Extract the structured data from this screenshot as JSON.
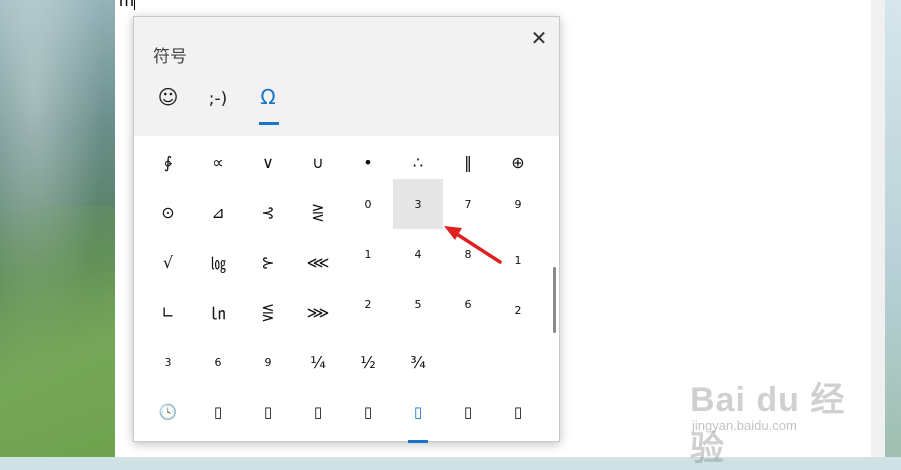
{
  "document": {
    "text": "m"
  },
  "panel": {
    "title": "符号",
    "close_glyph": "✕",
    "tabs": [
      {
        "label": "☺",
        "name": "emoji"
      },
      {
        "label": ";-)",
        "name": "kaomoji"
      },
      {
        "label": "Ω",
        "name": "symbols",
        "active": true
      }
    ],
    "symbols": [
      [
        "∳",
        "∝",
        "∨",
        "∪",
        "•",
        "∴",
        "‖",
        "⊕"
      ],
      [
        "⊙",
        "⊿",
        "⊰",
        "⋛",
        "0",
        "3",
        "7",
        "9"
      ],
      [
        "√",
        "㏒",
        "⊱",
        "⋘",
        "1",
        "4",
        "8",
        "1"
      ],
      [
        "∟",
        "㏑",
        "⋚",
        "⋙",
        "2",
        "5",
        "6",
        "2"
      ],
      [
        "3",
        "6",
        "9",
        "¼",
        "½",
        "¾",
        "",
        ""
      ]
    ],
    "bottom_categories": [
      "🕓",
      "▯",
      "▯",
      "▯",
      "▯",
      "▯",
      "▯",
      "▯"
    ],
    "highlighted_symbol": "3"
  },
  "watermark": {
    "main": "Bai du 经验",
    "sub": "jingyan.baidu.com"
  },
  "colors": {
    "accent": "#1a74c8",
    "annotation": "#e02020"
  }
}
